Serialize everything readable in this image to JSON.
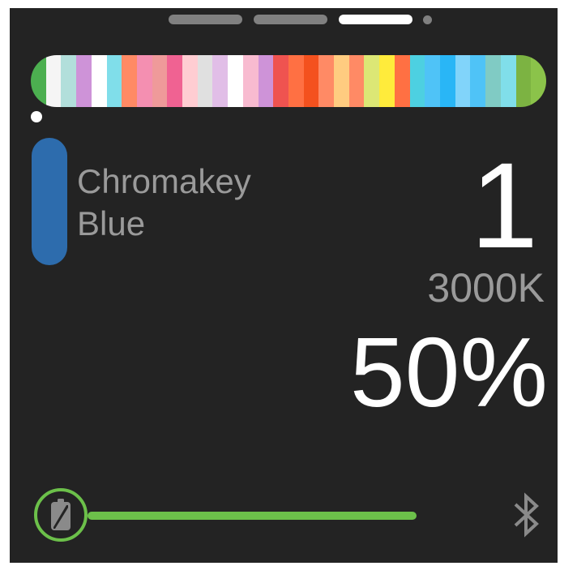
{
  "pager": {
    "pages": 4,
    "active_index": 2
  },
  "color_strip": {
    "selected_index": 0,
    "swatches": [
      "#4caf50",
      "#f5f5f5",
      "#b2dfdb",
      "#ce93d8",
      "#ffffff",
      "#80deea",
      "#ff8a65",
      "#f48fb1",
      "#ef9a9a",
      "#f06292",
      "#ffcdd2",
      "#e0e0e0",
      "#e1bee7",
      "#ffffff",
      "#f8bbd0",
      "#ce93d8",
      "#ef5350",
      "#ff7043",
      "#f4511e",
      "#ff8a65",
      "#ffcc80",
      "#ff8a65",
      "#dce775",
      "#ffeb3b",
      "#ff7043",
      "#4dd0e1",
      "#4fc3f7",
      "#29b6f6",
      "#81d4fa",
      "#4fc3f7",
      "#80cbc4",
      "#80deea",
      "#7cb342",
      "#8bc34a"
    ]
  },
  "gel": {
    "name_line1": "Chromakey",
    "name_line2": "Blue",
    "color": "#2d6cad",
    "number": "1",
    "cct": "3000K"
  },
  "intensity": "50%",
  "status": {
    "battery_level_percent": 90,
    "battery_color": "#6cc04a",
    "battery_icon": "battery-icon",
    "bluetooth_icon": "bluetooth-icon"
  }
}
